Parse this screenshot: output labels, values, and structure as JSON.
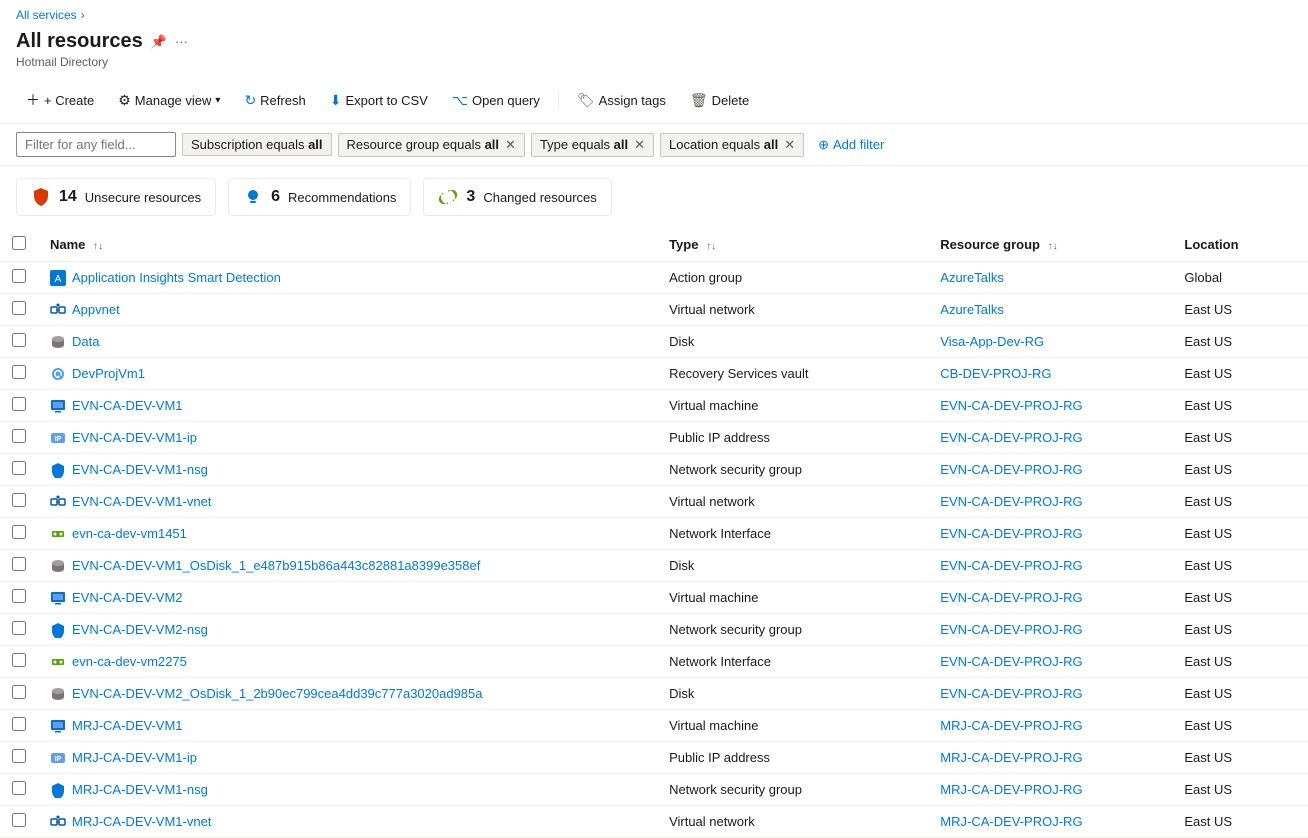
{
  "breadcrumb": {
    "label": "All services",
    "separator": "›"
  },
  "page": {
    "title": "All resources",
    "subtitle": "Hotmail Directory"
  },
  "toolbar": {
    "create_label": "+ Create",
    "manage_view_label": "Manage view",
    "refresh_label": "Refresh",
    "export_csv_label": "Export to CSV",
    "open_query_label": "Open query",
    "assign_tags_label": "Assign tags",
    "delete_label": "Delete"
  },
  "filters": {
    "input_placeholder": "Filter for any field...",
    "tags": [
      {
        "key": "Subscription equals",
        "value": "all",
        "closable": false
      },
      {
        "key": "Resource group equals",
        "value": "all",
        "closable": true
      },
      {
        "key": "Type equals",
        "value": "all",
        "closable": true
      },
      {
        "key": "Location equals",
        "value": "all",
        "closable": true
      }
    ],
    "add_filter_label": "Add filter"
  },
  "summary_cards": [
    {
      "icon": "shield",
      "count": "14",
      "label": "Unsecure resources",
      "color": "#d83b01"
    },
    {
      "icon": "lightbulb",
      "count": "6",
      "label": "Recommendations",
      "color": "#0078d4"
    },
    {
      "icon": "sync",
      "count": "3",
      "label": "Changed resources",
      "color": "#57a300"
    }
  ],
  "table": {
    "columns": [
      {
        "key": "name",
        "label": "Name",
        "sortable": true
      },
      {
        "key": "type",
        "label": "Type",
        "sortable": true
      },
      {
        "key": "resource_group",
        "label": "Resource group",
        "sortable": true
      },
      {
        "key": "location",
        "label": "Location",
        "sortable": false
      }
    ],
    "rows": [
      {
        "name": "Application Insights Smart Detection",
        "type": "Action group",
        "resource_group": "AzureTalks",
        "location": "Global",
        "icon_type": "action-group"
      },
      {
        "name": "Appvnet",
        "type": "Virtual network",
        "resource_group": "AzureTalks",
        "location": "East US",
        "icon_type": "vnet"
      },
      {
        "name": "Data",
        "type": "Disk",
        "resource_group": "Visa-App-Dev-RG",
        "location": "East US",
        "icon_type": "disk"
      },
      {
        "name": "DevProjVm1",
        "type": "Recovery Services vault",
        "resource_group": "CB-DEV-PROJ-RG",
        "location": "East US",
        "icon_type": "recovery"
      },
      {
        "name": "EVN-CA-DEV-VM1",
        "type": "Virtual machine",
        "resource_group": "EVN-CA-DEV-PROJ-RG",
        "location": "East US",
        "icon_type": "vm"
      },
      {
        "name": "EVN-CA-DEV-VM1-ip",
        "type": "Public IP address",
        "resource_group": "EVN-CA-DEV-PROJ-RG",
        "location": "East US",
        "icon_type": "ip"
      },
      {
        "name": "EVN-CA-DEV-VM1-nsg",
        "type": "Network security group",
        "resource_group": "EVN-CA-DEV-PROJ-RG",
        "location": "East US",
        "icon_type": "nsg"
      },
      {
        "name": "EVN-CA-DEV-VM1-vnet",
        "type": "Virtual network",
        "resource_group": "EVN-CA-DEV-PROJ-RG",
        "location": "East US",
        "icon_type": "vnet"
      },
      {
        "name": "evn-ca-dev-vm1451",
        "type": "Network Interface",
        "resource_group": "EVN-CA-DEV-PROJ-RG",
        "location": "East US",
        "icon_type": "nic"
      },
      {
        "name": "EVN-CA-DEV-VM1_OsDisk_1_e487b915b86a443c82881a8399e358ef",
        "type": "Disk",
        "resource_group": "EVN-CA-DEV-PROJ-RG",
        "location": "East US",
        "icon_type": "disk"
      },
      {
        "name": "EVN-CA-DEV-VM2",
        "type": "Virtual machine",
        "resource_group": "EVN-CA-DEV-PROJ-RG",
        "location": "East US",
        "icon_type": "vm"
      },
      {
        "name": "EVN-CA-DEV-VM2-nsg",
        "type": "Network security group",
        "resource_group": "EVN-CA-DEV-PROJ-RG",
        "location": "East US",
        "icon_type": "nsg"
      },
      {
        "name": "evn-ca-dev-vm2275",
        "type": "Network Interface",
        "resource_group": "EVN-CA-DEV-PROJ-RG",
        "location": "East US",
        "icon_type": "nic"
      },
      {
        "name": "EVN-CA-DEV-VM2_OsDisk_1_2b90ec799cea4dd39c777a3020ad985a",
        "type": "Disk",
        "resource_group": "EVN-CA-DEV-PROJ-RG",
        "location": "East US",
        "icon_type": "disk"
      },
      {
        "name": "MRJ-CA-DEV-VM1",
        "type": "Virtual machine",
        "resource_group": "MRJ-CA-DEV-PROJ-RG",
        "location": "East US",
        "icon_type": "vm"
      },
      {
        "name": "MRJ-CA-DEV-VM1-ip",
        "type": "Public IP address",
        "resource_group": "MRJ-CA-DEV-PROJ-RG",
        "location": "East US",
        "icon_type": "ip"
      },
      {
        "name": "MRJ-CA-DEV-VM1-nsg",
        "type": "Network security group",
        "resource_group": "MRJ-CA-DEV-PROJ-RG",
        "location": "East US",
        "icon_type": "nsg"
      },
      {
        "name": "MRJ-CA-DEV-VM1-vnet",
        "type": "Virtual network",
        "resource_group": "MRJ-CA-DEV-PROJ-RG",
        "location": "East US",
        "icon_type": "vnet"
      }
    ]
  }
}
